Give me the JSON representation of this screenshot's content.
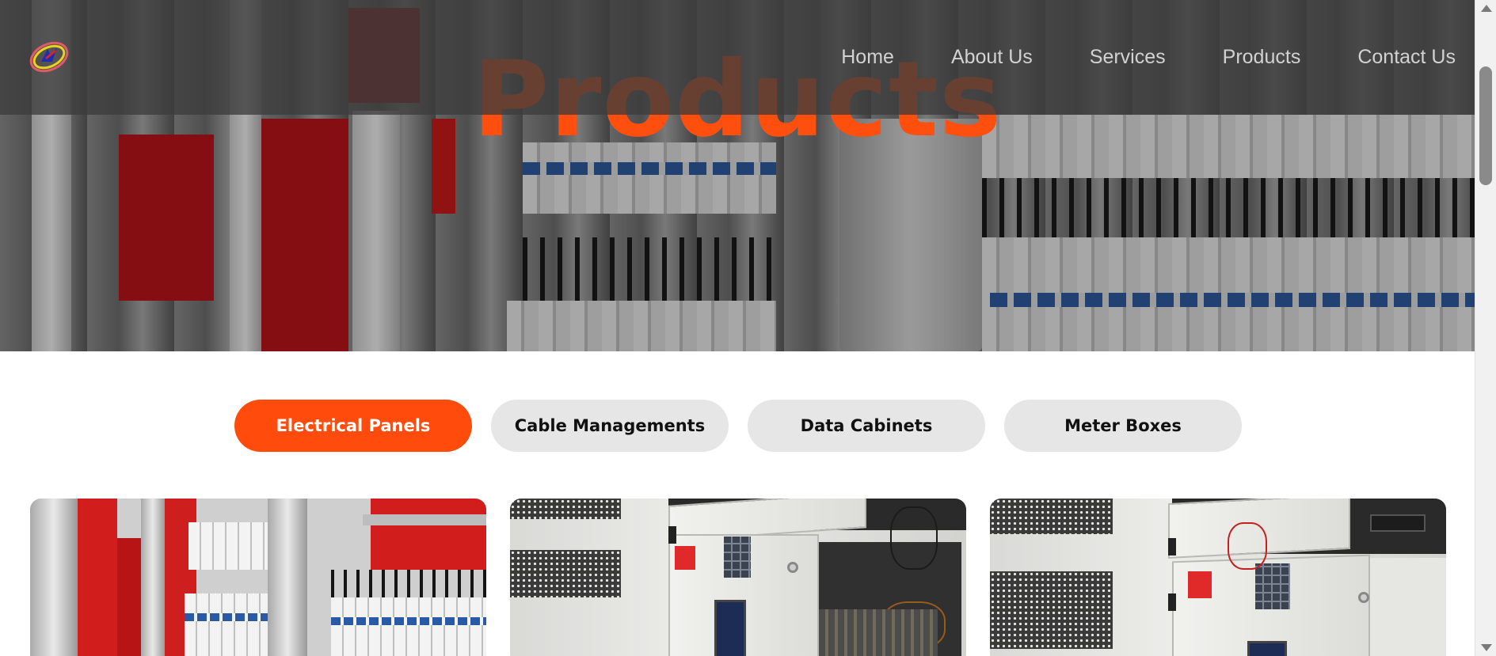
{
  "header": {
    "logo_alt": "Company logo",
    "nav": [
      {
        "label": "Home"
      },
      {
        "label": "About Us"
      },
      {
        "label": "Services"
      },
      {
        "label": "Products"
      },
      {
        "label": "Contact Us"
      }
    ]
  },
  "hero": {
    "title": "Products"
  },
  "tabs": [
    {
      "label": "Electrical Panels",
      "active": true
    },
    {
      "label": "Cable Managements",
      "active": false
    },
    {
      "label": "Data Cabinets",
      "active": false
    },
    {
      "label": "Meter Boxes",
      "active": false
    }
  ],
  "colors": {
    "accent": "#ff4c0c",
    "tab_inactive": "#e6e6e6",
    "header_overlay": "#3c3c3c"
  },
  "cards": [
    {
      "name": "electrical-panel-photo"
    },
    {
      "name": "cabinet-photo-1"
    },
    {
      "name": "cabinet-photo-2"
    }
  ]
}
